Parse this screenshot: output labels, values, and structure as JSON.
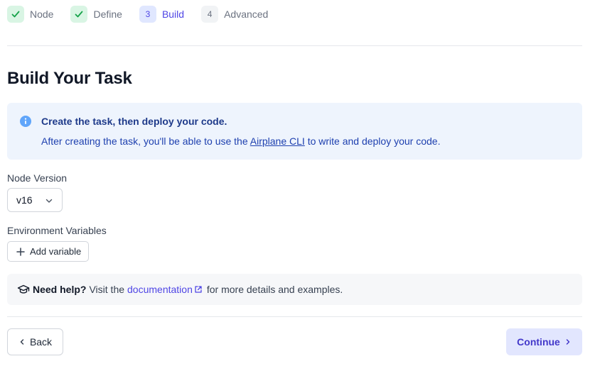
{
  "stepper": {
    "steps": [
      {
        "badge": "",
        "label": "Node",
        "state": "done"
      },
      {
        "badge": "",
        "label": "Define",
        "state": "done"
      },
      {
        "badge": "3",
        "label": "Build",
        "state": "active"
      },
      {
        "badge": "4",
        "label": "Advanced",
        "state": "pending"
      }
    ]
  },
  "page": {
    "title": "Build Your Task"
  },
  "info": {
    "icon": "info-icon",
    "title": "Create the task, then deploy your code.",
    "text_before": "After creating the task, you'll be able to use the",
    "link": "Airplane CLI",
    "text_after": "to write and deploy your code."
  },
  "node_version": {
    "label": "Node Version",
    "value": "v16"
  },
  "env_vars": {
    "label": "Environment Variables",
    "add_button": "Add variable"
  },
  "help": {
    "icon": "graduation-cap-icon",
    "strong": "Need help?",
    "text_before": "Visit the",
    "link": "documentation",
    "text_after": "for more details and examples."
  },
  "footer": {
    "back": "Back",
    "continue": "Continue"
  },
  "colors": {
    "accent": "#4f46e5",
    "success_bg": "#d9f5e4",
    "success": "#16a34a",
    "info_bg": "#eef4fd",
    "info": "#1e40af"
  }
}
